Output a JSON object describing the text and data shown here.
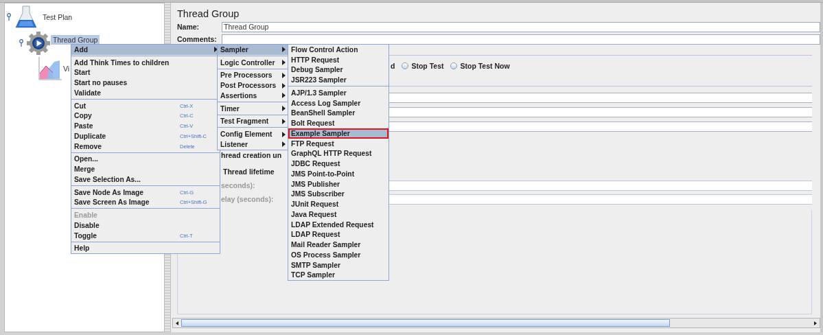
{
  "tree": [
    {
      "label": "Test Plan",
      "kind": "test-plan",
      "selected": false,
      "expanded": true,
      "children": [
        {
          "label": "Thread Group",
          "kind": "thread-group",
          "selected": true,
          "expanded": true,
          "children": [
            {
              "label": "Vi",
              "kind": "listener",
              "selected": false
            }
          ]
        }
      ]
    }
  ],
  "editor": {
    "title": "Thread Group",
    "fields": [
      {
        "label": "Name:",
        "value": "Thread Group"
      },
      {
        "label": "Comments:"
      }
    ],
    "error_action": {
      "label_tail": "d",
      "options": [
        {
          "label": "Stop Test",
          "selected": false
        },
        {
          "label": "Stop Test Now",
          "selected": false
        }
      ]
    },
    "thread_properties": [
      {
        "label": "hread creation un",
        "disabled": false,
        "has_field": false
      },
      {
        "label": "Thread lifetime",
        "disabled": false,
        "has_field": false
      },
      {
        "label": "seconds):",
        "disabled": true,
        "has_field": true
      },
      {
        "label": "elay (seconds):",
        "disabled": true,
        "has_field": true
      }
    ]
  },
  "context_menu": {
    "groups": [
      [
        {
          "label": "Add",
          "submenu": true,
          "selected": true,
          "disabled": false
        }
      ],
      [
        {
          "label": "Add Think Times to children",
          "submenu": false,
          "selected": false,
          "disabled": false
        },
        {
          "label": "Start",
          "submenu": false,
          "selected": false,
          "disabled": false
        },
        {
          "label": "Start no pauses",
          "submenu": false,
          "selected": false,
          "disabled": false
        },
        {
          "label": "Validate",
          "submenu": false,
          "selected": false,
          "disabled": false
        }
      ],
      [
        {
          "label": "Cut",
          "shortcut": "Ctrl-X",
          "submenu": false,
          "selected": false,
          "disabled": false
        },
        {
          "label": "Copy",
          "shortcut": "Ctrl-C",
          "submenu": false,
          "selected": false,
          "disabled": false
        },
        {
          "label": "Paste",
          "shortcut": "Ctrl-V",
          "submenu": false,
          "selected": false,
          "disabled": false
        },
        {
          "label": "Duplicate",
          "shortcut": "Ctrl+Shift-C",
          "submenu": false,
          "selected": false,
          "disabled": false
        },
        {
          "label": "Remove",
          "shortcut": "Delete",
          "submenu": false,
          "selected": false,
          "disabled": false
        }
      ],
      [
        {
          "label": "Open...",
          "submenu": false,
          "selected": false,
          "disabled": false
        },
        {
          "label": "Merge",
          "submenu": false,
          "selected": false,
          "disabled": false
        },
        {
          "label": "Save Selection As...",
          "submenu": false,
          "selected": false,
          "disabled": false
        }
      ],
      [
        {
          "label": "Save Node As Image",
          "shortcut": "Ctrl-G",
          "submenu": false,
          "selected": false,
          "disabled": false
        },
        {
          "label": "Save Screen As Image",
          "shortcut": "Ctrl+Shift-G",
          "submenu": false,
          "selected": false,
          "disabled": false
        }
      ],
      [
        {
          "label": "Enable",
          "submenu": false,
          "selected": false,
          "disabled": true
        },
        {
          "label": "Disable",
          "submenu": false,
          "selected": false,
          "disabled": false
        },
        {
          "label": "Toggle",
          "shortcut": "Ctrl-T",
          "submenu": false,
          "selected": false,
          "disabled": false
        }
      ],
      [
        {
          "label": "Help",
          "submenu": false,
          "selected": false,
          "disabled": false
        }
      ]
    ]
  },
  "add_submenu": {
    "groups": [
      [
        {
          "label": "Sampler",
          "submenu": true,
          "selected": true
        }
      ],
      [
        {
          "label": "Logic Controller",
          "submenu": true,
          "selected": false
        }
      ],
      [
        {
          "label": "Pre Processors",
          "submenu": true,
          "selected": false
        },
        {
          "label": "Post Processors",
          "submenu": true,
          "selected": false
        },
        {
          "label": "Assertions",
          "submenu": true,
          "selected": false
        }
      ],
      [
        {
          "label": "Timer",
          "submenu": true,
          "selected": false
        }
      ],
      [
        {
          "label": "Test Fragment",
          "submenu": true,
          "selected": false
        }
      ],
      [
        {
          "label": "Config Element",
          "submenu": true,
          "selected": false
        },
        {
          "label": "Listener",
          "submenu": true,
          "selected": false
        }
      ]
    ]
  },
  "sampler_submenu": {
    "groups": [
      [
        {
          "label": "Flow Control Action",
          "selected": false,
          "annotated": false
        },
        {
          "label": "HTTP Request",
          "selected": false,
          "annotated": false
        },
        {
          "label": "Debug Sampler",
          "selected": false,
          "annotated": false
        },
        {
          "label": "JSR223 Sampler",
          "selected": false,
          "annotated": false
        }
      ],
      [
        {
          "label": "AJP/1.3 Sampler",
          "selected": false,
          "annotated": false
        },
        {
          "label": "Access Log Sampler",
          "selected": false,
          "annotated": false
        },
        {
          "label": "BeanShell Sampler",
          "selected": false,
          "annotated": false
        },
        {
          "label": "Bolt Request",
          "selected": false,
          "annotated": false
        },
        {
          "label": "Example Sampler",
          "selected": true,
          "annotated": true
        },
        {
          "label": "FTP Request",
          "selected": false,
          "annotated": false
        },
        {
          "label": "GraphQL HTTP Request",
          "selected": false,
          "annotated": false
        },
        {
          "label": "JDBC Request",
          "selected": false,
          "annotated": false
        },
        {
          "label": "JMS Point-to-Point",
          "selected": false,
          "annotated": false
        },
        {
          "label": "JMS Publisher",
          "selected": false,
          "annotated": false
        },
        {
          "label": "JMS Subscriber",
          "selected": false,
          "annotated": false
        },
        {
          "label": "JUnit Request",
          "selected": false,
          "annotated": false
        },
        {
          "label": "Java Request",
          "selected": false,
          "annotated": false
        },
        {
          "label": "LDAP Extended Request",
          "selected": false,
          "annotated": false
        },
        {
          "label": "LDAP Request",
          "selected": false,
          "annotated": false
        },
        {
          "label": "Mail Reader Sampler",
          "selected": false,
          "annotated": false
        },
        {
          "label": "OS Process Sampler",
          "selected": false,
          "annotated": false
        },
        {
          "label": "SMTP Sampler",
          "selected": false,
          "annotated": false
        },
        {
          "label": "TCP Sampler",
          "selected": false,
          "annotated": false
        }
      ]
    ]
  }
}
